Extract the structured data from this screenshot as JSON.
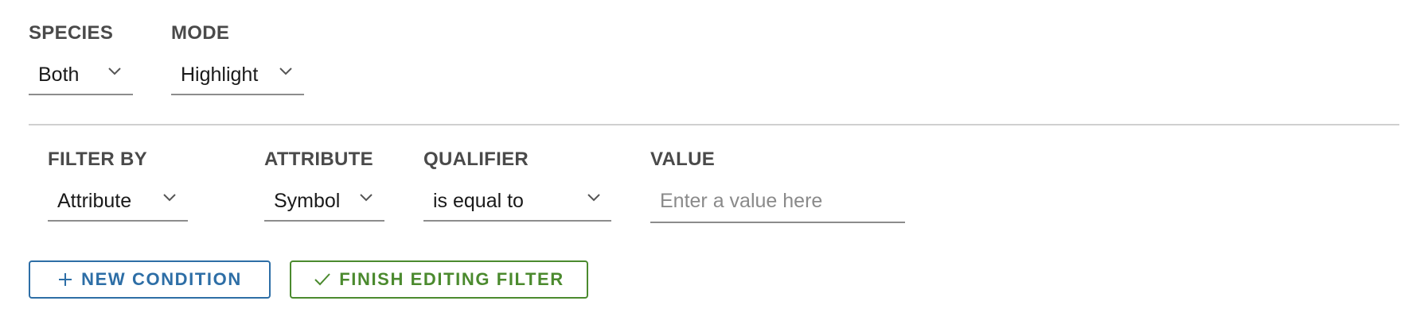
{
  "top_row": {
    "species": {
      "label": "SPECIES",
      "value": "Both"
    },
    "mode": {
      "label": "MODE",
      "value": "Highlight"
    }
  },
  "filter_row": {
    "filter_by": {
      "label": "FILTER BY",
      "value": "Attribute"
    },
    "attribute": {
      "label": "ATTRIBUTE",
      "value": "Symbol"
    },
    "qualifier": {
      "label": "QUALIFIER",
      "value": "is equal to"
    },
    "value": {
      "label": "VALUE",
      "value": "",
      "placeholder": "Enter a value here"
    }
  },
  "actions": {
    "new_condition_label": "NEW CONDITION",
    "finish_editing_label": "FINISH EDITING FILTER"
  },
  "colors": {
    "primary_blue": "#2d6ea6",
    "success_green": "#4b8a2e",
    "label_gray": "#4a4a4a",
    "underline_gray": "#8c8c8c",
    "divider_gray": "#d0d0d0"
  },
  "icons": {
    "select_arrow": "chevron-down-icon",
    "new_condition": "plus-icon",
    "finish_editing": "checkmark-icon"
  }
}
